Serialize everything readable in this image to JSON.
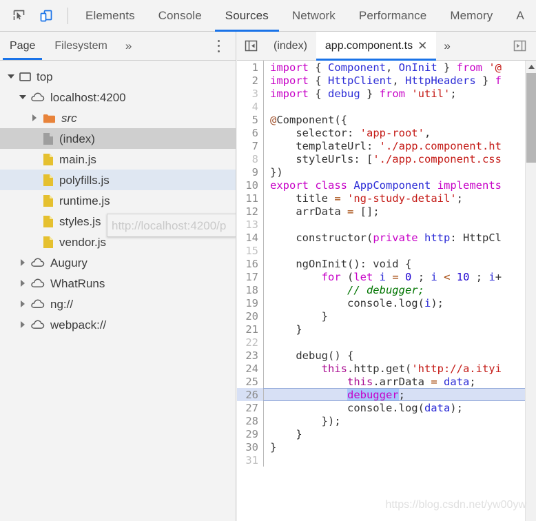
{
  "toolbar": {
    "inspect_icon": "inspect-element-icon",
    "device_icon": "device-toolbar-icon",
    "tabs": [
      {
        "label": "Elements",
        "active": false
      },
      {
        "label": "Console",
        "active": false
      },
      {
        "label": "Sources",
        "active": true
      },
      {
        "label": "Network",
        "active": false
      },
      {
        "label": "Performance",
        "active": false
      },
      {
        "label": "Memory",
        "active": false
      },
      {
        "label": "A",
        "active": false
      }
    ],
    "accent_color": "#1a73e8"
  },
  "sidebar": {
    "tabs": [
      {
        "label": "Page",
        "active": true
      },
      {
        "label": "Filesystem",
        "active": false
      }
    ],
    "more_label": "»",
    "menu_icon": "more-options-icon",
    "tree": [
      {
        "label": "top",
        "icon": "frame-icon",
        "twist": "open",
        "indent": 0,
        "state": "normal",
        "italic": false
      },
      {
        "label": "localhost:4200",
        "icon": "cloud-icon",
        "twist": "open",
        "indent": 1,
        "state": "normal",
        "italic": false
      },
      {
        "label": "src",
        "icon": "folder-icon",
        "twist": "closed",
        "indent": 2,
        "state": "normal",
        "italic": true
      },
      {
        "label": "(index)",
        "icon": "doc-gray-icon",
        "twist": "none",
        "indent": 2,
        "state": "sel",
        "italic": false
      },
      {
        "label": "main.js",
        "icon": "doc-js-icon",
        "twist": "none",
        "indent": 2,
        "state": "normal",
        "italic": false
      },
      {
        "label": "polyfills.js",
        "icon": "doc-js-icon",
        "twist": "none",
        "indent": 2,
        "state": "hover",
        "italic": false
      },
      {
        "label": "runtime.js",
        "icon": "doc-js-icon",
        "twist": "none",
        "indent": 2,
        "state": "normal",
        "italic": false
      },
      {
        "label": "styles.js",
        "icon": "doc-js-icon",
        "twist": "none",
        "indent": 2,
        "state": "normal",
        "italic": false
      },
      {
        "label": "vendor.js",
        "icon": "doc-js-icon",
        "twist": "none",
        "indent": 2,
        "state": "normal",
        "italic": false
      },
      {
        "label": "Augury",
        "icon": "cloud-icon",
        "twist": "closed",
        "indent": 1,
        "state": "normal",
        "italic": false
      },
      {
        "label": "WhatRuns",
        "icon": "cloud-icon",
        "twist": "closed",
        "indent": 1,
        "state": "normal",
        "italic": false
      },
      {
        "label": "ng://",
        "icon": "cloud-icon",
        "twist": "closed",
        "indent": 1,
        "state": "normal",
        "italic": false
      },
      {
        "label": "webpack://",
        "icon": "cloud-icon",
        "twist": "closed",
        "indent": 1,
        "state": "normal",
        "italic": false
      }
    ],
    "tooltip": "http://localhost:4200/p"
  },
  "editor": {
    "nav_back_icon": "show-navigator-icon",
    "nav_fwd_icon": "show-debugger-icon",
    "more_label": "»",
    "tabs": [
      {
        "label": "(index)",
        "active": false,
        "closable": false
      },
      {
        "label": "app.component.ts",
        "active": true,
        "closable": true,
        "close_label": "✕"
      }
    ],
    "highlight_line": 26,
    "selected_token": "debugger",
    "lines": [
      {
        "n": 1,
        "blank": false
      },
      {
        "n": 2,
        "blank": false
      },
      {
        "n": 3,
        "blank": false
      },
      {
        "n": 4,
        "blank": true
      },
      {
        "n": 5,
        "blank": false
      },
      {
        "n": 6,
        "blank": false
      },
      {
        "n": 7,
        "blank": false
      },
      {
        "n": 8,
        "blank": false
      },
      {
        "n": 9,
        "blank": false
      },
      {
        "n": 10,
        "blank": false
      },
      {
        "n": 11,
        "blank": false
      },
      {
        "n": 12,
        "blank": false
      },
      {
        "n": 13,
        "blank": true
      },
      {
        "n": 14,
        "blank": false
      },
      {
        "n": 15,
        "blank": true
      },
      {
        "n": 16,
        "blank": false
      },
      {
        "n": 17,
        "blank": false
      },
      {
        "n": 18,
        "blank": false
      },
      {
        "n": 19,
        "blank": false
      },
      {
        "n": 20,
        "blank": false
      },
      {
        "n": 21,
        "blank": false
      },
      {
        "n": 22,
        "blank": true
      },
      {
        "n": 23,
        "blank": false
      },
      {
        "n": 24,
        "blank": false
      },
      {
        "n": 25,
        "blank": false
      },
      {
        "n": 26,
        "blank": false
      },
      {
        "n": 27,
        "blank": false
      },
      {
        "n": 28,
        "blank": false
      },
      {
        "n": 29,
        "blank": false
      },
      {
        "n": 30,
        "blank": false
      },
      {
        "n": 31,
        "blank": true
      }
    ],
    "source_text": {
      "l1": "import { Component, OnInit } from '@",
      "l2": "import { HttpClient, HttpHeaders } f",
      "l3": "import { debug } from 'util';",
      "l5": "@Component({",
      "l6": "    selector: 'app-root',",
      "l7": "    templateUrl: './app.component.ht",
      "l8": "    styleUrls: ['./app.component.css",
      "l9": "})",
      "l10": "export class AppComponent implements",
      "l11": "    title = 'ng-study-detail';",
      "l12": "    arrData = [];",
      "l14": "    constructor(private http: HttpCl",
      "l16": "    ngOnInit(): void {",
      "l17": "        for (let i = 0 ; i < 10 ; i+",
      "l18": "            // debugger;",
      "l19": "            console.log(i);",
      "l20": "        }",
      "l21": "    }",
      "l23": "    debug() {",
      "l24": "        this.http.get('http://a.ityi",
      "l25": "            this.arrData = data;",
      "l26": "            debugger;",
      "l27": "            console.log(data);",
      "l28": "        });",
      "l29": "    }",
      "l30": "}"
    },
    "scrollbar": {
      "up_icon": "scroll-up-icon"
    }
  },
  "watermark": "https://blog.csdn.net/yw00yw"
}
